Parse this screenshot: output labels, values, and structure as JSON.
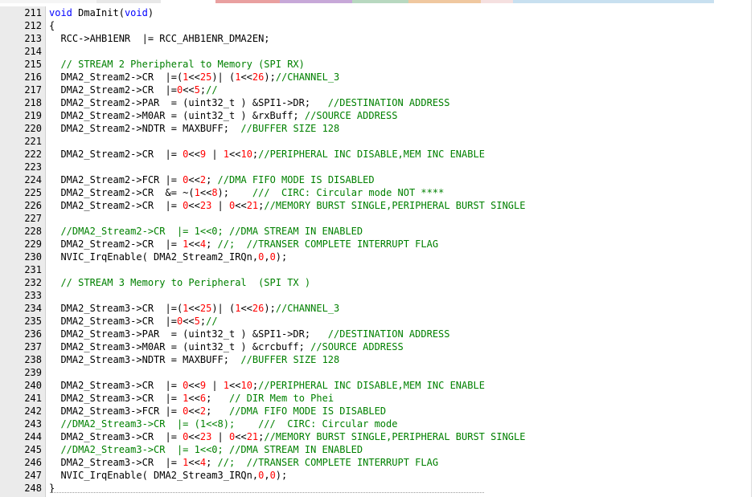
{
  "tabbar": {
    "colors": [
      "#f5f5f5",
      "#e8e8e8",
      "#ffffff",
      "#e9a0a0",
      "#c7a8d8",
      "#b8d8c0",
      "#f0c8a0",
      "#f5e0e0",
      "#c8e0f0"
    ]
  },
  "editor": {
    "language": "C",
    "colors": {
      "keyword": "#0000ff",
      "number": "#ff0000",
      "comment": "#008000",
      "gutter": "#ebebeb"
    },
    "lines": [
      {
        "n": "211",
        "t": [
          [
            "kw",
            "void"
          ],
          [
            "p",
            " DmaInit("
          ],
          [
            "kw",
            "void"
          ],
          [
            "p",
            ")"
          ]
        ]
      },
      {
        "n": "212",
        "t": [
          [
            "p",
            "{"
          ]
        ]
      },
      {
        "n": "213",
        "t": [
          [
            "p",
            "  RCC->AHB1ENR  |= RCC_AHB1ENR_DMA2EN;"
          ]
        ]
      },
      {
        "n": "214",
        "t": []
      },
      {
        "n": "215",
        "t": [
          [
            "com",
            "  // STREAM 2 Pheripheral to Memory (SPI RX)"
          ]
        ]
      },
      {
        "n": "216",
        "t": [
          [
            "p",
            "  DMA2_Stream2->CR  |=("
          ],
          [
            "num",
            "1"
          ],
          [
            "p",
            "<<"
          ],
          [
            "num",
            "25"
          ],
          [
            "p",
            ")| ("
          ],
          [
            "num",
            "1"
          ],
          [
            "p",
            "<<"
          ],
          [
            "num",
            "26"
          ],
          [
            "p",
            ");"
          ],
          [
            "com",
            "//CHANNEL_3"
          ]
        ]
      },
      {
        "n": "217",
        "t": [
          [
            "p",
            "  DMA2_Stream2->CR  |="
          ],
          [
            "num",
            "0"
          ],
          [
            "p",
            "<<"
          ],
          [
            "num",
            "5"
          ],
          [
            "p",
            ";"
          ],
          [
            "com",
            "//"
          ]
        ]
      },
      {
        "n": "218",
        "t": [
          [
            "p",
            "  DMA2_Stream2->PAR  = (uint32_t ) &SPI1->DR;   "
          ],
          [
            "com",
            "//DESTINATION ADDRESS"
          ]
        ]
      },
      {
        "n": "219",
        "t": [
          [
            "p",
            "  DMA2_Stream2->M0AR = (uint32_t ) &rxBuff; "
          ],
          [
            "com",
            "//SOURCE ADDRESS"
          ]
        ]
      },
      {
        "n": "220",
        "t": [
          [
            "p",
            "  DMA2_Stream2->NDTR = MAXBUFF;  "
          ],
          [
            "com",
            "//BUFFER SIZE 128"
          ]
        ]
      },
      {
        "n": "221",
        "t": []
      },
      {
        "n": "222",
        "t": [
          [
            "p",
            "  DMA2_Stream2->CR  |= "
          ],
          [
            "num",
            "0"
          ],
          [
            "p",
            "<<"
          ],
          [
            "num",
            "9"
          ],
          [
            "p",
            " | "
          ],
          [
            "num",
            "1"
          ],
          [
            "p",
            "<<"
          ],
          [
            "num",
            "10"
          ],
          [
            "p",
            ";"
          ],
          [
            "com",
            "//PERIPHERAL INC DISABLE,MEM INC ENABLE"
          ]
        ]
      },
      {
        "n": "223",
        "t": []
      },
      {
        "n": "224",
        "t": [
          [
            "p",
            "  DMA2_Stream2->FCR |= "
          ],
          [
            "num",
            "0"
          ],
          [
            "p",
            "<<"
          ],
          [
            "num",
            "2"
          ],
          [
            "p",
            "; "
          ],
          [
            "com",
            "//DMA FIFO MODE IS DISABLED"
          ]
        ]
      },
      {
        "n": "225",
        "t": [
          [
            "p",
            "  DMA2_Stream2->CR  &= ~("
          ],
          [
            "num",
            "1"
          ],
          [
            "p",
            "<<"
          ],
          [
            "num",
            "8"
          ],
          [
            "p",
            ");    "
          ],
          [
            "com",
            "///  CIRC: Circular mode NOT ****"
          ]
        ]
      },
      {
        "n": "226",
        "t": [
          [
            "p",
            "  DMA2_Stream2->CR  |= "
          ],
          [
            "num",
            "0"
          ],
          [
            "p",
            "<<"
          ],
          [
            "num",
            "23"
          ],
          [
            "p",
            " | "
          ],
          [
            "num",
            "0"
          ],
          [
            "p",
            "<<"
          ],
          [
            "num",
            "21"
          ],
          [
            "p",
            ";"
          ],
          [
            "com",
            "//MEMORY BURST SINGLE,PERIPHERAL BURST SINGLE"
          ]
        ]
      },
      {
        "n": "227",
        "t": []
      },
      {
        "n": "228",
        "t": [
          [
            "com",
            "  //DMA2_Stream2->CR  |= 1<<0; //DMA STREAM IN ENABLED"
          ]
        ]
      },
      {
        "n": "229",
        "t": [
          [
            "p",
            "  DMA2_Stream2->CR  |= "
          ],
          [
            "num",
            "1"
          ],
          [
            "p",
            "<<"
          ],
          [
            "num",
            "4"
          ],
          [
            "p",
            "; "
          ],
          [
            "com",
            "//;  //TRANSER COMPLETE INTERRUPT FLAG"
          ]
        ]
      },
      {
        "n": "230",
        "t": [
          [
            "p",
            "  NVIC_IrqEnable( DMA2_Stream2_IRQn,"
          ],
          [
            "num",
            "0"
          ],
          [
            "p",
            ","
          ],
          [
            "num",
            "0"
          ],
          [
            "p",
            ");"
          ]
        ]
      },
      {
        "n": "231",
        "t": []
      },
      {
        "n": "232",
        "t": [
          [
            "com",
            "  // STREAM 3 Memory to Peripheral  (SPI TX )"
          ]
        ]
      },
      {
        "n": "233",
        "t": []
      },
      {
        "n": "234",
        "t": [
          [
            "p",
            "  DMA2_Stream3->CR  |=("
          ],
          [
            "num",
            "1"
          ],
          [
            "p",
            "<<"
          ],
          [
            "num",
            "25"
          ],
          [
            "p",
            ")| ("
          ],
          [
            "num",
            "1"
          ],
          [
            "p",
            "<<"
          ],
          [
            "num",
            "26"
          ],
          [
            "p",
            ");"
          ],
          [
            "com",
            "//CHANNEL_3"
          ]
        ]
      },
      {
        "n": "235",
        "t": [
          [
            "p",
            "  DMA2_Stream3->CR  |="
          ],
          [
            "num",
            "0"
          ],
          [
            "p",
            "<<"
          ],
          [
            "num",
            "5"
          ],
          [
            "p",
            ";"
          ],
          [
            "com",
            "//"
          ]
        ]
      },
      {
        "n": "236",
        "t": [
          [
            "p",
            "  DMA2_Stream3->PAR  = (uint32_t ) &SPI1->DR;   "
          ],
          [
            "com",
            "//DESTINATION ADDRESS"
          ]
        ]
      },
      {
        "n": "237",
        "t": [
          [
            "p",
            "  DMA2_Stream3->M0AR = (uint32_t ) &crcbuff; "
          ],
          [
            "com",
            "//SOURCE ADDRESS"
          ]
        ]
      },
      {
        "n": "238",
        "t": [
          [
            "p",
            "  DMA2_Stream3->NDTR = MAXBUFF;  "
          ],
          [
            "com",
            "//BUFFER SIZE 128"
          ]
        ]
      },
      {
        "n": "239",
        "t": []
      },
      {
        "n": "240",
        "t": [
          [
            "p",
            "  DMA2_Stream3->CR  |= "
          ],
          [
            "num",
            "0"
          ],
          [
            "p",
            "<<"
          ],
          [
            "num",
            "9"
          ],
          [
            "p",
            " | "
          ],
          [
            "num",
            "1"
          ],
          [
            "p",
            "<<"
          ],
          [
            "num",
            "10"
          ],
          [
            "p",
            ";"
          ],
          [
            "com",
            "//PERIPHERAL INC DISABLE,MEM INC ENABLE"
          ]
        ]
      },
      {
        "n": "241",
        "t": [
          [
            "p",
            "  DMA2_Stream3->CR  |= "
          ],
          [
            "num",
            "1"
          ],
          [
            "p",
            "<<"
          ],
          [
            "num",
            "6"
          ],
          [
            "p",
            ";   "
          ],
          [
            "com",
            "// DIR Mem to Phei"
          ]
        ]
      },
      {
        "n": "242",
        "t": [
          [
            "p",
            "  DMA2_Stream3->FCR |= "
          ],
          [
            "num",
            "0"
          ],
          [
            "p",
            "<<"
          ],
          [
            "num",
            "2"
          ],
          [
            "p",
            ";   "
          ],
          [
            "com",
            "//DMA FIFO MODE IS DISABLED"
          ]
        ]
      },
      {
        "n": "243",
        "t": [
          [
            "com",
            "  //DMA2_Stream3->CR  |= (1<<8);    ///  CIRC: Circular mode"
          ]
        ]
      },
      {
        "n": "244",
        "t": [
          [
            "p",
            "  DMA2_Stream3->CR  |= "
          ],
          [
            "num",
            "0"
          ],
          [
            "p",
            "<<"
          ],
          [
            "num",
            "23"
          ],
          [
            "p",
            " | "
          ],
          [
            "num",
            "0"
          ],
          [
            "p",
            "<<"
          ],
          [
            "num",
            "21"
          ],
          [
            "p",
            ";"
          ],
          [
            "com",
            "//MEMORY BURST SINGLE,PERIPHERAL BURST SINGLE"
          ]
        ]
      },
      {
        "n": "245",
        "t": [
          [
            "com",
            "  //DMA2_Stream3->CR  |= 1<<0; //DMA STREAM IN ENABLED"
          ]
        ]
      },
      {
        "n": "246",
        "t": [
          [
            "p",
            "  DMA2_Stream3->CR  |= "
          ],
          [
            "num",
            "1"
          ],
          [
            "p",
            "<<"
          ],
          [
            "num",
            "4"
          ],
          [
            "p",
            "; "
          ],
          [
            "com",
            "//;  //TRANSER COMPLETE INTERRUPT FLAG"
          ]
        ]
      },
      {
        "n": "247",
        "t": [
          [
            "p",
            "  NVIC_IrqEnable( DMA2_Stream3_IRQn,"
          ],
          [
            "num",
            "0"
          ],
          [
            "p",
            ","
          ],
          [
            "num",
            "0"
          ],
          [
            "p",
            ");"
          ]
        ]
      },
      {
        "n": "248",
        "t": [
          [
            "p",
            "}"
          ]
        ]
      }
    ]
  }
}
